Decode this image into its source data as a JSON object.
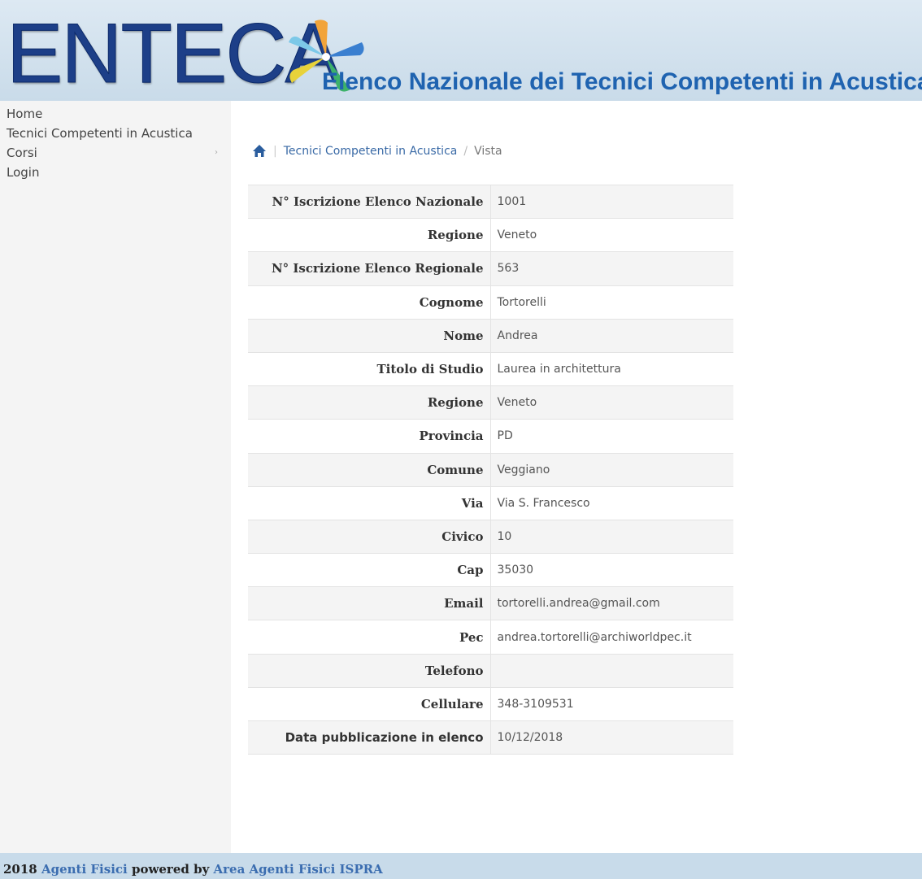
{
  "header": {
    "logo": "ENTECA",
    "subtitle": "Elenco Nazionale dei Tecnici Competenti in Acustica"
  },
  "sidebar": {
    "items": [
      {
        "label": "Home"
      },
      {
        "label": "Tecnici Competenti in Acustica"
      },
      {
        "label": "Corsi",
        "caret": "›"
      },
      {
        "label": "Login"
      }
    ]
  },
  "breadcrumb": {
    "link": "Tecnici Competenti in Acustica",
    "separator": "/",
    "current": "Vista"
  },
  "details": [
    {
      "label": "N° Iscrizione Elenco Nazionale",
      "value": "1001"
    },
    {
      "label": "Regione",
      "value": "Veneto"
    },
    {
      "label": "N° Iscrizione Elenco Regionale",
      "value": "563"
    },
    {
      "label": "Cognome",
      "value": "Tortorelli"
    },
    {
      "label": "Nome",
      "value": "Andrea"
    },
    {
      "label": "Titolo di Studio",
      "value": "Laurea in architettura"
    },
    {
      "label": "Regione",
      "value": "Veneto"
    },
    {
      "label": "Provincia",
      "value": "PD"
    },
    {
      "label": "Comune",
      "value": "Veggiano"
    },
    {
      "label": "Via",
      "value": "Via S. Francesco"
    },
    {
      "label": "Civico",
      "value": "10"
    },
    {
      "label": "Cap",
      "value": "35030"
    },
    {
      "label": "Email",
      "value": "tortorelli.andrea@gmail.com"
    },
    {
      "label": "Pec",
      "value": "andrea.tortorelli@archiworldpec.it"
    },
    {
      "label": "Telefono",
      "value": ""
    },
    {
      "label": "Cellulare",
      "value": "348-3109531"
    },
    {
      "label": "Data pubblicazione in elenco",
      "value": "10/12/2018"
    }
  ],
  "footer": {
    "year": "2018",
    "link1": "Agenti Fisici",
    "middle": "powered by",
    "link2": "Area Agenti Fisici ISPRA"
  }
}
